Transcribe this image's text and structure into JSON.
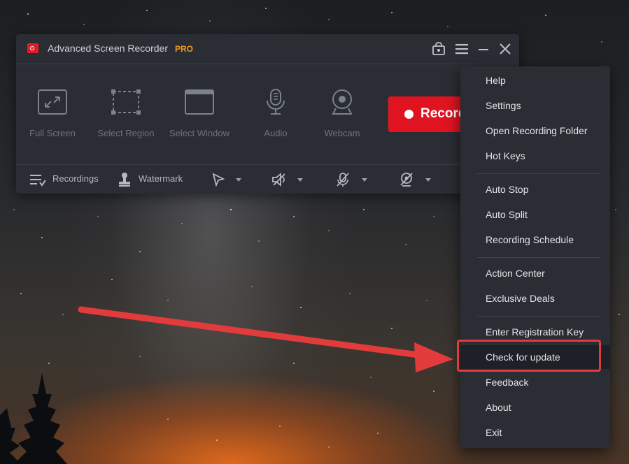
{
  "window": {
    "title": "Advanced Screen Recorder",
    "badge": "PRO"
  },
  "titlebar_icons": [
    "lock-icon",
    "hamburger-menu-icon",
    "minimize-icon",
    "close-icon"
  ],
  "tools": [
    {
      "label": "Full Screen",
      "icon": "full-screen-icon"
    },
    {
      "label": "Select Region",
      "icon": "select-region-icon"
    },
    {
      "label": "Select Window",
      "icon": "select-window-icon"
    },
    {
      "label": "Audio",
      "icon": "microphone-icon"
    },
    {
      "label": "Webcam",
      "icon": "webcam-icon"
    }
  ],
  "record_button": {
    "label": "Record"
  },
  "bottombar": {
    "recordings_label": "Recordings",
    "watermark_label": "Watermark",
    "dropdowns": [
      "cursor-icon",
      "speaker-mute-icon",
      "mic-mute-icon",
      "webcam-off-icon"
    ]
  },
  "menu": {
    "items": [
      "Help",
      "Settings",
      "Open Recording Folder",
      "Hot Keys",
      "Auto Stop",
      "Auto Split",
      "Recording Schedule",
      "Action Center",
      "Exclusive Deals",
      "Enter Registration Key",
      "Check for update",
      "Feedback",
      "About",
      "Exit"
    ],
    "selected": "Check for update"
  },
  "colors": {
    "accent_red": "#e01421",
    "pro_orange": "#f39c12",
    "annotation_red": "#e23b3b",
    "window_bg": "#2a2d33"
  }
}
